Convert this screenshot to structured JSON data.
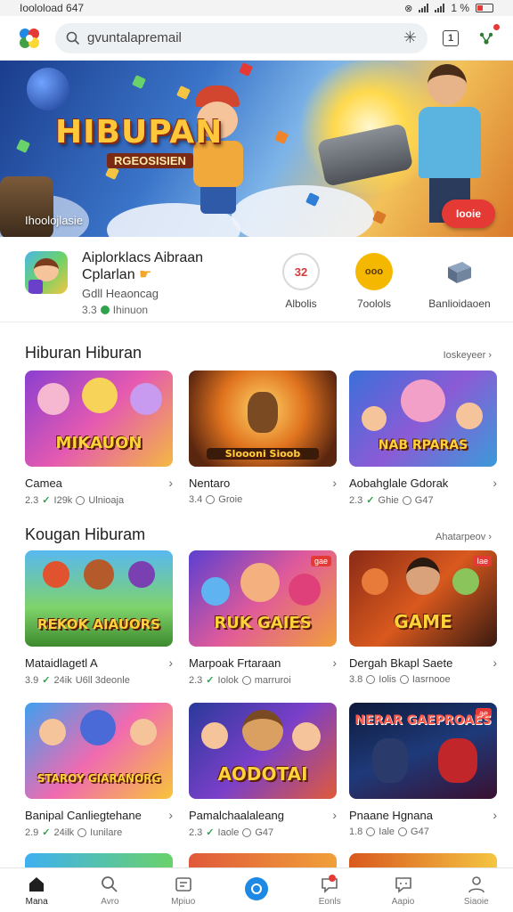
{
  "status_bar": {
    "time": "Iooloload 647",
    "battery": "1 %"
  },
  "search": {
    "value": "gvuntalapremail"
  },
  "top_bar": {
    "tab_count": "1"
  },
  "hero": {
    "title": "HIBUPAN",
    "subtitle": "RGEOSISIEN",
    "caption": "Ihoolojlasie",
    "button_label": "Iooie"
  },
  "featured": {
    "title_line1": "Aiplorklacs Aibraan",
    "title_line2": "Cplarlan",
    "developer": "Gdll Heaoncag",
    "rating": "3.3",
    "rating_label": "Ihinuon",
    "shortcuts": [
      {
        "label": "Albolis",
        "icon_text": "32"
      },
      {
        "label": "7oolols",
        "icon_text": "ooo"
      },
      {
        "label": "Banlioidaoen",
        "icon_text": ""
      }
    ]
  },
  "section1": {
    "title": "Hiburan Hiburan",
    "more": "Ioskeyeer",
    "cards": [
      {
        "thumb_text": "MIKAUON",
        "name": "Camea",
        "rating": "2.3",
        "size": "I29k",
        "extra": "Ulnioaja"
      },
      {
        "thumb_text": "Sloooni Sioob",
        "name": "Nentaro",
        "rating": "3.4",
        "size": "Groie",
        "extra": ""
      },
      {
        "thumb_text": "NAB RPARAS",
        "name": "Aobahglale Gdorak",
        "rating": "2.3",
        "size": "Ghie",
        "extra": "G47"
      }
    ]
  },
  "section2": {
    "title": "Kougan Hiburam",
    "more": "Ahatarpeov",
    "cards": [
      {
        "thumb_text": "REKOK AIAUORS",
        "name": "Mataidlagetl A",
        "rating": "3.9",
        "size": "24ik",
        "extra": "U6ll 3deonle"
      },
      {
        "thumb_text": "RUK GAIES",
        "name": "Marpoak Frtaraan",
        "rating": "2.3",
        "size": "Iolok",
        "extra": "marruroi",
        "tag": "gae"
      },
      {
        "thumb_text": "GAME",
        "name": "Dergah Bkapl Saete",
        "rating": "3.8",
        "size": "Iolis",
        "extra": "Iasrnooe",
        "tag": "Iae"
      },
      {
        "thumb_text": "STAROY GIARANORG",
        "name": "Banipal Canliegtehane",
        "rating": "2.9",
        "size": "24ilk",
        "extra": "Iunilare"
      },
      {
        "thumb_text": "AODOTAI",
        "name": "Pamalchaalaleang",
        "rating": "2.3",
        "size": "Iaole",
        "extra": "G47"
      },
      {
        "thumb_text": "NERAR GAEPROAES",
        "name": "Pnaane Hgnana",
        "rating": "1.8",
        "size": "Iale",
        "extra": "G47",
        "tag": "ae"
      }
    ]
  },
  "bottom_nav": [
    {
      "label": "Mana",
      "icon": "home-icon"
    },
    {
      "label": "Avro",
      "icon": "search-icon"
    },
    {
      "label": "Mpiuo",
      "icon": "apps-icon"
    },
    {
      "label": "",
      "icon": "center-icon"
    },
    {
      "label": "Eonls",
      "icon": "chat-icon"
    },
    {
      "label": "Aapio",
      "icon": "message-icon"
    },
    {
      "label": "Siaoie",
      "icon": "profile-icon"
    }
  ]
}
